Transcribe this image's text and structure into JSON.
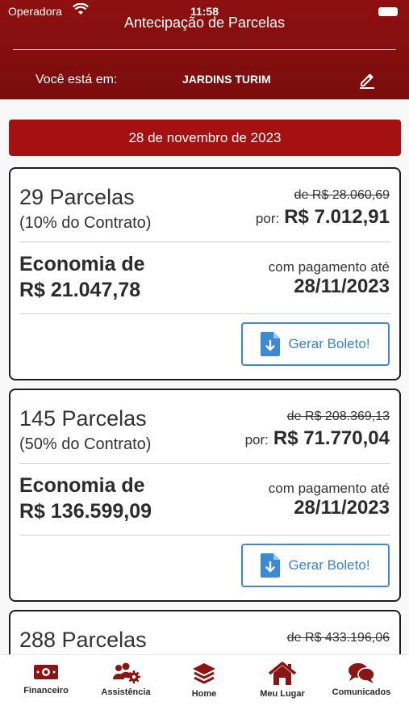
{
  "status_bar": {
    "carrier": "Operadora",
    "time": "11:58"
  },
  "header": {
    "title": "Antecipação de Parcelas",
    "location_label": "Você está em:",
    "location_value": "JARDINS TURIM"
  },
  "date_banner": "28 de novembro de 2023",
  "cards": [
    {
      "installments": "29 Parcelas",
      "contract_pct": "(10% do Contrato)",
      "old_price": "de R$ 28.060,69",
      "por_label": "por:",
      "price": "R$ 7.012,91",
      "savings_label": "Economia de",
      "savings_value": "R$ 21.047,78",
      "payment_label": "com pagamento até",
      "payment_date": "28/11/2023",
      "button_label": "Gerar Boleto!"
    },
    {
      "installments": "145 Parcelas",
      "contract_pct": "(50% do Contrato)",
      "old_price": "de R$ 208.369,13",
      "por_label": "por:",
      "price": "R$ 71.770,04",
      "savings_label": "Economia de",
      "savings_value": "R$ 136.599,09",
      "payment_label": "com pagamento até",
      "payment_date": "28/11/2023",
      "button_label": "Gerar Boleto!"
    },
    {
      "installments": "288 Parcelas",
      "old_price": "de R$ 433.196,06"
    }
  ],
  "tabs": [
    {
      "label": "Financeiro",
      "icon": "money-icon"
    },
    {
      "label": "Assistência",
      "icon": "users-gear-icon"
    },
    {
      "label": "Home",
      "icon": "layers-icon"
    },
    {
      "label": "Meu Lugar",
      "icon": "house-icon"
    },
    {
      "label": "Comunicados",
      "icon": "chat-bubbles-icon"
    }
  ],
  "colors": {
    "header_bg": "#8e1010",
    "accent_red": "#a51010",
    "button_blue": "#3c8ad6",
    "tab_icon": "#8b1515"
  }
}
